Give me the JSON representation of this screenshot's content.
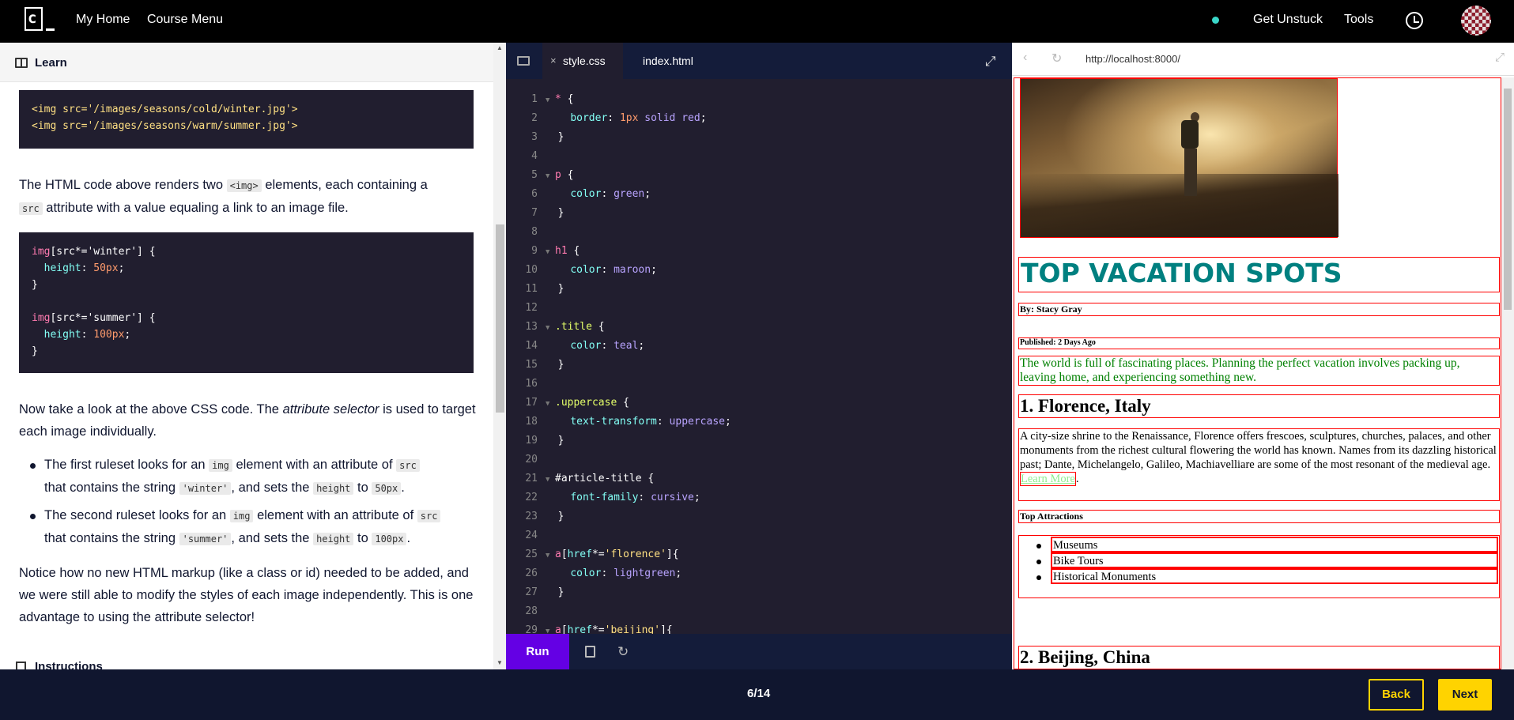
{
  "nav": {
    "my_home": "My Home",
    "course_menu": "Course Menu",
    "get_unstuck": "Get Unstuck",
    "tools": "Tools"
  },
  "learn": {
    "title": "Learn",
    "html_code": [
      "<img src='/images/seasons/cold/winter.jpg'>",
      "<img src='/images/seasons/warm/summer.jpg'>"
    ],
    "para1_a": "The HTML code above renders two ",
    "para1_code1": "<img>",
    "para1_b": " elements, each containing a",
    "para1_code2": "src",
    "para1_c": " attribute with a value equaling a link to an image file.",
    "css_code": {
      "sel1": "img",
      "attr1": "[src*='winter'] {",
      "prop1": "height",
      "val1": "50px",
      "sel2": "img",
      "attr2": "[src*='summer'] {",
      "prop2": "height",
      "val2": "100px"
    },
    "para2_a": "Now take a look at the above CSS code. The ",
    "para2_em": "attribute selector",
    "para2_b": " is used to target each image individually.",
    "bullets": [
      {
        "a": "The first ruleset looks for an ",
        "c1": "img",
        "b": " element with an attribute of ",
        "c2": "src",
        "c": "that contains the string ",
        "c3": "'winter'",
        "d": ", and sets the ",
        "c4": "height",
        "e": " to ",
        "c5": "50px",
        "f": "."
      },
      {
        "a": "The second ruleset looks for an ",
        "c1": "img",
        "b": " element with an attribute of ",
        "c2": "src",
        "c": "that contains the string ",
        "c3": "'summer'",
        "d": ", and sets the ",
        "c4": "height",
        "e": " to ",
        "c5": "100px",
        "f": "."
      }
    ],
    "para3": "Notice how no new HTML markup (like a class or id) needed to be added, and we were still able to modify the styles of each image independently. This is one advantage to using the attribute selector!",
    "instructions": "Instructions"
  },
  "editor": {
    "tabs": [
      "style.css",
      "index.html"
    ],
    "line_numbers": [
      "1",
      "2",
      "3",
      "4",
      "5",
      "6",
      "7",
      "8",
      "9",
      "10",
      "11",
      "12",
      "13",
      "14",
      "15",
      "16",
      "17",
      "18",
      "19",
      "20",
      "21",
      "22",
      "23",
      "24",
      "25",
      "26",
      "27",
      "28",
      "29"
    ],
    "run_label": "Run"
  },
  "browser": {
    "url": "http://localhost:8000/",
    "h1": "Top Vacation Spots",
    "byline": "By: Stacy Gray",
    "published": "Published: 2 Days Ago",
    "intro": "The world is full of fascinating places. Planning the perfect vacation involves packing up, leaving home, and experiencing something new.",
    "h2_1": "1. Florence, Italy",
    "florence_text": "A city-size shrine to the Renaissance, Florence offers frescoes, sculptures, churches, palaces, and other monuments from the richest cultural flowering the world has known. Names from its dazzling historical past; Dante, Michelangelo, Galileo, Machiavelliare are some of the most resonant of the medieval age. ",
    "learn_more": "Learn More",
    "top_attractions": "Top Attractions",
    "attractions": [
      "Museums",
      "Bike Tours",
      "Historical Monuments"
    ],
    "h2_2": "2. Beijing, China"
  },
  "footer": {
    "progress": "6/14",
    "back": "Back",
    "next": "Next"
  },
  "colors": {
    "nav_bg": "#000000",
    "accent_purple": "#6400e4",
    "accent_yellow": "#ffd300",
    "editor_bg": "#211e2f",
    "footer_bg": "#10162f"
  }
}
